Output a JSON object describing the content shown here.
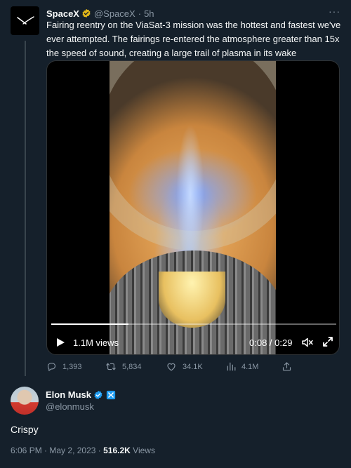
{
  "tweet": {
    "author_name": "SpaceX",
    "author_handle": "@SpaceX",
    "separator": "·",
    "time_ago": "5h",
    "more_label": "···",
    "text": "Fairing reentry on the ViaSat-3 mission was the hottest and fastest we've ever attempted.  The fairings re-entered the atmosphere greater than 15x the speed of sound, creating a large trail of plasma in its wake",
    "video": {
      "views": "1.1M views",
      "time": "0:08 / 0:29",
      "progress": 0.27
    },
    "actions": {
      "replies": "1,393",
      "retweets": "5,834",
      "likes": "34.1K",
      "views": "4.1M"
    }
  },
  "reply": {
    "author_name": "Elon Musk",
    "author_handle": "@elonmusk",
    "text": "Crispy",
    "time": "6:06 PM",
    "separator": "·",
    "date": "May 2, 2023",
    "views_count": "516.2K",
    "views_label": "Views"
  },
  "colors": {
    "background": "#15202b",
    "muted": "#8b98a5",
    "verified_gold": "#e2b719",
    "verified_blue": "#1d9bf0"
  }
}
